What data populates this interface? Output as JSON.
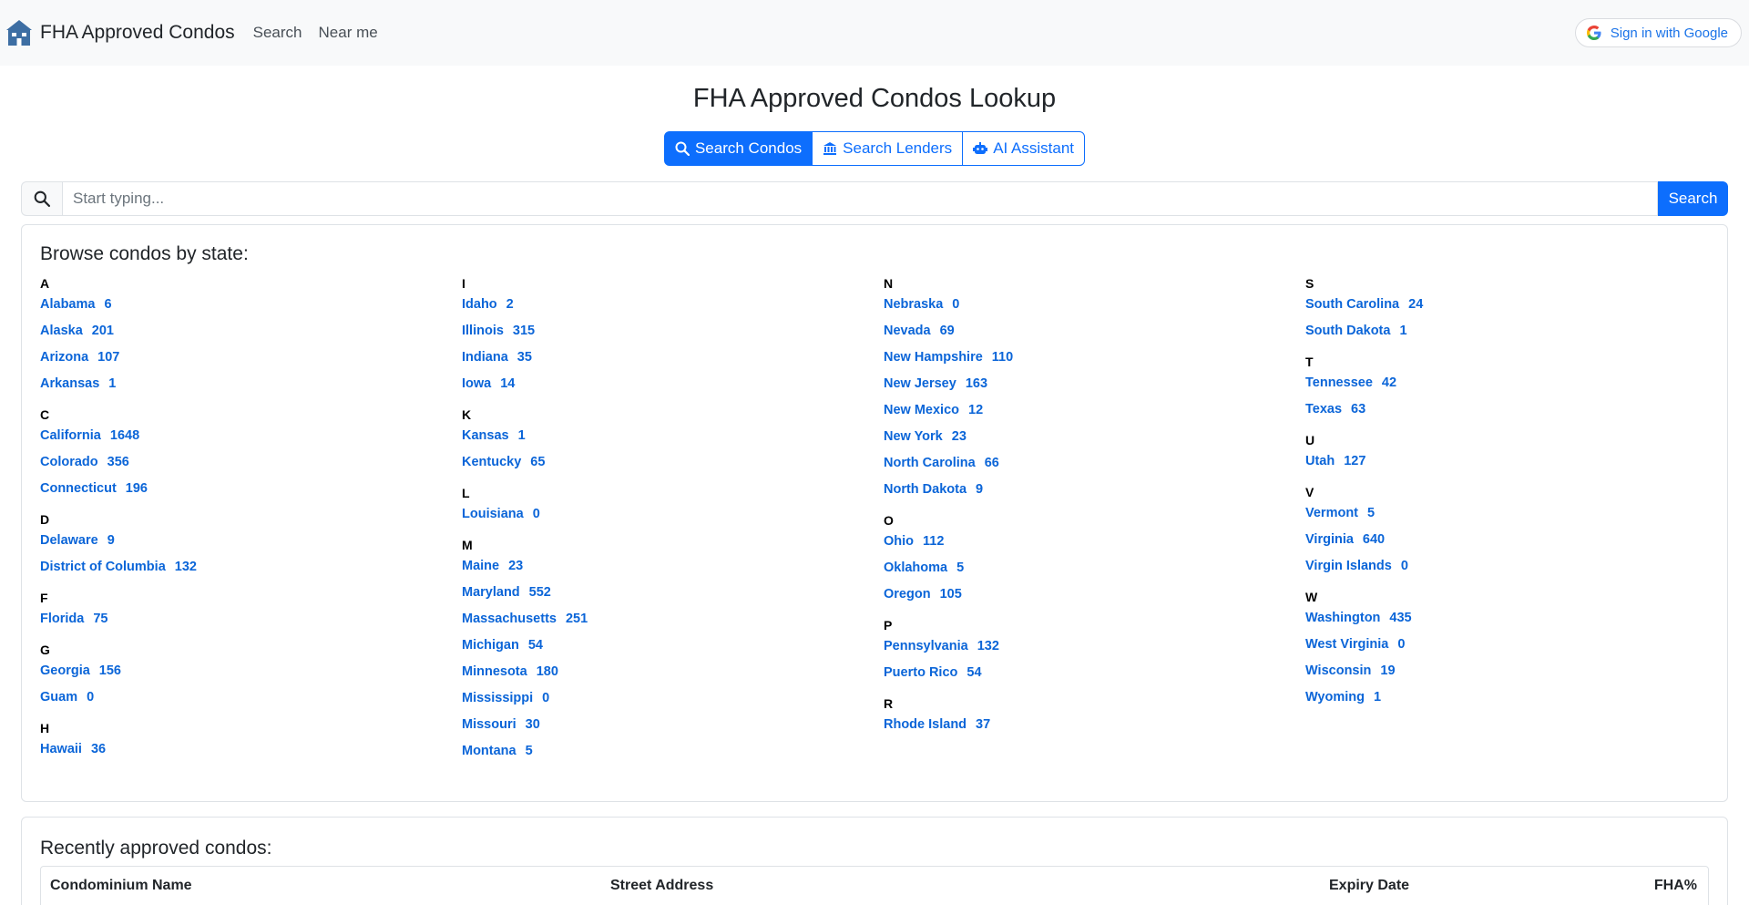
{
  "navbar": {
    "brand": "FHA Approved Condos",
    "links": [
      "Search",
      "Near me"
    ],
    "signin": "Sign in with Google"
  },
  "page": {
    "title": "FHA Approved Condos Lookup"
  },
  "tabs": [
    {
      "label": "Search Condos",
      "icon": "search-icon"
    },
    {
      "label": "Search Lenders",
      "icon": "bank-icon"
    },
    {
      "label": "AI Assistant",
      "icon": "robot-icon"
    }
  ],
  "search": {
    "placeholder": "Start typing...",
    "button": "Search"
  },
  "browse": {
    "title": "Browse condos by state:",
    "columns": [
      [
        {
          "letter": "A",
          "states": [
            [
              "Alabama",
              "6"
            ],
            [
              "Alaska",
              "201"
            ],
            [
              "Arizona",
              "107"
            ],
            [
              "Arkansas",
              "1"
            ]
          ]
        },
        {
          "letter": "C",
          "states": [
            [
              "California",
              "1648"
            ],
            [
              "Colorado",
              "356"
            ],
            [
              "Connecticut",
              "196"
            ]
          ]
        },
        {
          "letter": "D",
          "states": [
            [
              "Delaware",
              "9"
            ],
            [
              "District of Columbia",
              "132"
            ]
          ]
        },
        {
          "letter": "F",
          "states": [
            [
              "Florida",
              "75"
            ]
          ]
        },
        {
          "letter": "G",
          "states": [
            [
              "Georgia",
              "156"
            ],
            [
              "Guam",
              "0"
            ]
          ]
        },
        {
          "letter": "H",
          "states": [
            [
              "Hawaii",
              "36"
            ]
          ]
        }
      ],
      [
        {
          "letter": "I",
          "states": [
            [
              "Idaho",
              "2"
            ],
            [
              "Illinois",
              "315"
            ],
            [
              "Indiana",
              "35"
            ],
            [
              "Iowa",
              "14"
            ]
          ]
        },
        {
          "letter": "K",
          "states": [
            [
              "Kansas",
              "1"
            ],
            [
              "Kentucky",
              "65"
            ]
          ]
        },
        {
          "letter": "L",
          "states": [
            [
              "Louisiana",
              "0"
            ]
          ]
        },
        {
          "letter": "M",
          "states": [
            [
              "Maine",
              "23"
            ],
            [
              "Maryland",
              "552"
            ],
            [
              "Massachusetts",
              "251"
            ],
            [
              "Michigan",
              "54"
            ],
            [
              "Minnesota",
              "180"
            ],
            [
              "Mississippi",
              "0"
            ],
            [
              "Missouri",
              "30"
            ],
            [
              "Montana",
              "5"
            ]
          ]
        }
      ],
      [
        {
          "letter": "N",
          "states": [
            [
              "Nebraska",
              "0"
            ],
            [
              "Nevada",
              "69"
            ],
            [
              "New Hampshire",
              "110"
            ],
            [
              "New Jersey",
              "163"
            ],
            [
              "New Mexico",
              "12"
            ],
            [
              "New York",
              "23"
            ],
            [
              "North Carolina",
              "66"
            ],
            [
              "North Dakota",
              "9"
            ]
          ]
        },
        {
          "letter": "O",
          "states": [
            [
              "Ohio",
              "112"
            ],
            [
              "Oklahoma",
              "5"
            ],
            [
              "Oregon",
              "105"
            ]
          ]
        },
        {
          "letter": "P",
          "states": [
            [
              "Pennsylvania",
              "132"
            ],
            [
              "Puerto Rico",
              "54"
            ]
          ]
        },
        {
          "letter": "R",
          "states": [
            [
              "Rhode Island",
              "37"
            ]
          ]
        }
      ],
      [
        {
          "letter": "S",
          "states": [
            [
              "South Carolina",
              "24"
            ],
            [
              "South Dakota",
              "1"
            ]
          ]
        },
        {
          "letter": "T",
          "states": [
            [
              "Tennessee",
              "42"
            ],
            [
              "Texas",
              "63"
            ]
          ]
        },
        {
          "letter": "U",
          "states": [
            [
              "Utah",
              "127"
            ]
          ]
        },
        {
          "letter": "V",
          "states": [
            [
              "Vermont",
              "5"
            ],
            [
              "Virginia",
              "640"
            ],
            [
              "Virgin Islands",
              "0"
            ]
          ]
        },
        {
          "letter": "W",
          "states": [
            [
              "Washington",
              "435"
            ],
            [
              "West Virginia",
              "0"
            ],
            [
              "Wisconsin",
              "19"
            ],
            [
              "Wyoming",
              "1"
            ]
          ]
        }
      ]
    ]
  },
  "recent": {
    "title": "Recently approved condos:",
    "headers": [
      "Condominium Name",
      "Street Address",
      "Expiry Date",
      "FHA%"
    ]
  }
}
